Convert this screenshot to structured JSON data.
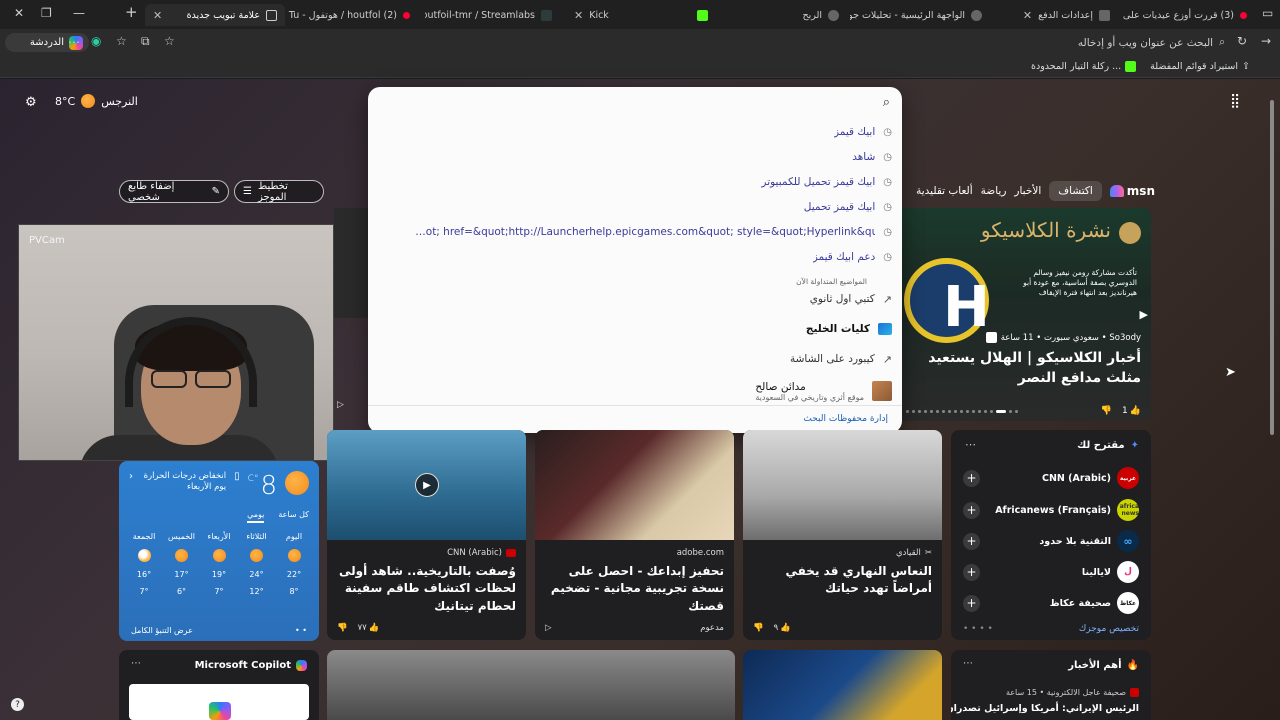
{
  "tabs": [
    {
      "title": "(3) قررت أوزع عيديات على ال",
      "favicon_color": "#ff0033"
    },
    {
      "title": "إعدادات الدفع",
      "favicon_color": "#7a7a7a"
    },
    {
      "title": "الواجهة الرئيسية - تحليلات جوا",
      "favicon_color": "#7a7a7a"
    },
    {
      "title": "الربح",
      "favicon_color": "#7a7a7a"
    },
    {
      "title": "Kick",
      "favicon_color": "#53fc18"
    },
    {
      "title": "houtfoil-tmr / Streamlabs",
      "favicon_color": "#80f5d2"
    },
    {
      "title": "(2) houtfol / هوتفول - YouTu",
      "favicon_color": "#ff0033"
    },
    {
      "title": "علامة تبويب جديدة",
      "favicon_color": "#d0d0d0"
    }
  ],
  "toolbar": {
    "profile_label": "الدردشة",
    "omnibox_placeholder": "البحث عن عنوان ويب أو إدخاله"
  },
  "bookmarks": [
    {
      "label": "استيراد قوائم المفضلة"
    },
    {
      "label": "ركلة التيار المحدودة ..."
    }
  ],
  "weather_top": {
    "city": "النرجس",
    "temp": "8°C"
  },
  "search": {
    "history": [
      "ابيك قيمز",
      "شاهد",
      "ابيك قيمز تحميل للكمبيوتر",
      "ابيك قيمز تحميل",
      "…ot; href=&quot;http://Launcherhelp.epicgames.com&quot; style=&quot;Hyperlink&quot;&gt&",
      "دعم ابيك قيمز"
    ],
    "trending_header": "المواضيع المتداولة الآن",
    "trending": [
      {
        "text": "كتبي اول ثانوي",
        "bold": false
      },
      {
        "text": "كليات الخليج",
        "bold": true
      },
      {
        "text": "كيبورد على الشاشة",
        "bold": false
      }
    ],
    "place": {
      "title": "مدائن صالح",
      "subtitle": "موقع أثري وتاريخي في السعودية"
    },
    "manage_link": "إدارة محفوظات البحث"
  },
  "msn": {
    "brand": "msn",
    "nav": [
      "اكتشاف",
      "الأخبار",
      "رياضة",
      "ألعاب تقليدية"
    ],
    "layout_button": "تخطيط الموجز",
    "personalize_button": "إضفاء طابع شخصي"
  },
  "hero": {
    "banner": "نشرة الكلاسيكو",
    "small_text": "تأكدت مشاركة رومن نيفيز وسالم الدوسري بصفة أساسية، مع عودة أبو هيرنانديز بعد انتهاء فترة الإيقاف",
    "source": "So3ody • سعودي سبورت • 11 ساعة",
    "title": "أخبار الكلاسيكو | الهلال يستعيد مثلث مدافع النصر",
    "likes": "1"
  },
  "webcam": {
    "label": "PVCam"
  },
  "weather_card": {
    "temp": "8",
    "unit": "°C",
    "description": "انخفاض درجات الحرارة يوم الأربعاء",
    "tabs": [
      "كل ساعة",
      "يومي"
    ],
    "days": [
      {
        "name": "اليوم",
        "high": "22°",
        "low": "8°"
      },
      {
        "name": "الثلاثاء",
        "high": "24°",
        "low": "12°"
      },
      {
        "name": "الأربعاء",
        "high": "19°",
        "low": "7°"
      },
      {
        "name": "الخميس",
        "high": "17°",
        "low": "6°"
      },
      {
        "name": "الجمعة",
        "high": "16°",
        "low": "7°"
      }
    ],
    "footer": "عرض التنبؤ الكامل"
  },
  "cards": [
    {
      "source": "القيادي",
      "title": "النعاس النهاري قد يخفي أمراضاً تهدد حياتك",
      "likes": "٩"
    },
    {
      "source": "adobe.com",
      "title": "تحفيز إبداعك - احصل على نسخة تجريبية مجانية - تضخيم قصتك",
      "sponsored": "مدعوم"
    },
    {
      "source": "CNN (Arabic)",
      "title": "وُصفت بالتاريخية.. شاهد أولى لحظات اكتشاف طاقم سفينة لحطام تيتانيك",
      "likes": "٧٧"
    }
  ],
  "suggested": {
    "title": "مقترح لك",
    "items": [
      {
        "name": "CNN (Arabic)",
        "logo": "عربية",
        "color": "#cc0000"
      },
      {
        "name": "Africanews (Français)",
        "logo": "africa news",
        "color": "#c9d400"
      },
      {
        "name": "التقنية بلا حدود",
        "logo": "∞",
        "color": "#0a62c9"
      },
      {
        "name": "لايالينا",
        "logo": "ل",
        "color": "#e82f7a"
      },
      {
        "name": "صحيفة عكاظ",
        "logo": "عكاظ",
        "color": "#ffffff"
      }
    ],
    "footer": "تخصيص موجزك"
  },
  "bottom": {
    "copilot": "Microsoft Copilot",
    "top_news": "أهم الأخبار",
    "top_news_source": "صحيفة عاجل الالكترونية • 15 ساعة",
    "top_news_title": "الرئيس الإيراني: أمريكا وإسرائيل تصدران"
  }
}
